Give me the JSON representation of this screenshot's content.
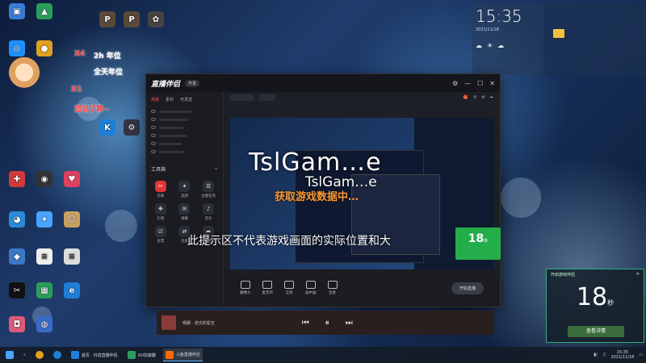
{
  "desktop": {
    "overlays": {
      "x4": "X4",
      "year": "2h 年位",
      "allday": "全天年位",
      "x1": "X1",
      "said": "您说了算~"
    }
  },
  "app": {
    "logo": "直播伴侣",
    "badge": "开发",
    "left_tabs": [
      "场景",
      "素材",
      "可发送"
    ],
    "tools_title": "工具箱",
    "tools": [
      "剪裁",
      "美颜",
      "主播任务",
      "礼物",
      "弹幕",
      "音乐",
      "投票",
      "连麦",
      "分享"
    ],
    "bottom_buttons": [
      "摄像头",
      "麦克风",
      "全屏",
      "画中画",
      "连麦"
    ],
    "start_label": "开始直播"
  },
  "watermarks": {
    "big": "TslGam…e",
    "small": "TslGam…e",
    "orange": "获取游戏数据中…",
    "hint": "此提示区不代表游戏画面的实际位置和大"
  },
  "clock": {
    "time": "15:35",
    "date": "2021/11/18"
  },
  "timer": {
    "header": "开启游戏伴侣",
    "value": "18",
    "unit": "秒",
    "action": "查看详情",
    "small_value": "18",
    "small_unit": "秒"
  },
  "player": {
    "track": "晴朗 · 流光的星空"
  },
  "taskbar": {
    "items": [
      "首页 · 抖音直播伴侣",
      "UU加速器",
      "斗鱼直播伴侣"
    ],
    "time": "15:35",
    "date": "2021/11/18"
  }
}
